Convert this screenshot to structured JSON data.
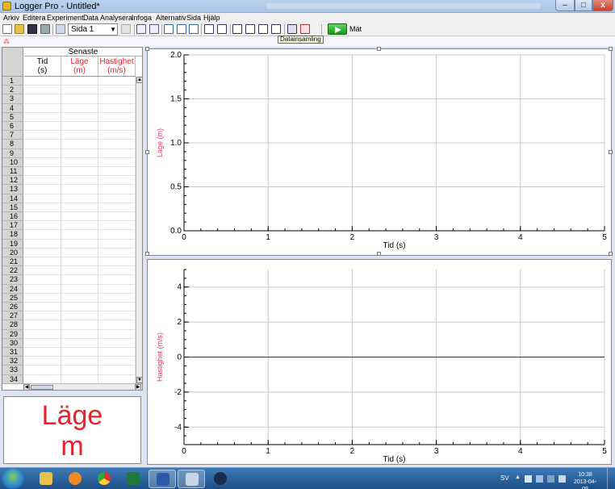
{
  "window": {
    "title": "Logger Pro - Untitled*"
  },
  "menu": [
    "Arkiv",
    "Editera",
    "Experiment",
    "Data",
    "Analysera",
    "Infoga",
    "Alternativ",
    "Sida",
    "Hjälp"
  ],
  "toolbar": {
    "page_select": "Sida 1",
    "collect_label": "Mät",
    "tooltip": "Datainsamling"
  },
  "table": {
    "group_header": "Senaste",
    "columns": [
      {
        "name": "Tid",
        "unit": "(s)",
        "color": "#000000"
      },
      {
        "name": "Läge",
        "unit": "(m)",
        "color": "#e8222d"
      },
      {
        "name": "Hastighet",
        "unit": "(m/s)",
        "color": "#e8222d"
      }
    ],
    "row_numbers": [
      "1",
      "2",
      "3",
      "4",
      "5",
      "6",
      "7",
      "8",
      "9",
      "10",
      "11",
      "12",
      "13",
      "14",
      "15",
      "16",
      "17",
      "18",
      "19",
      "20",
      "21",
      "22",
      "23",
      "24",
      "25",
      "26",
      "27",
      "28",
      "29",
      "30",
      "31",
      "32",
      "33",
      "34"
    ]
  },
  "meter": {
    "label": "Läge",
    "unit": "m",
    "color": "#e8222d"
  },
  "chart_data": [
    {
      "type": "line",
      "title": "",
      "xlabel": "Tid (s)",
      "ylabel": "Läge (m)",
      "xlim": [
        0,
        5
      ],
      "ylim": [
        0,
        2
      ],
      "x_ticks": [
        "0",
        "1",
        "2",
        "3",
        "4",
        "5"
      ],
      "y_ticks": [
        "0.0",
        "0.5",
        "1.0",
        "1.5",
        "2.0"
      ],
      "grid": true,
      "series": []
    },
    {
      "type": "line",
      "title": "",
      "xlabel": "Tid (s)",
      "ylabel": "Hastighet (m/s)",
      "xlim": [
        0,
        5
      ],
      "ylim": [
        -5,
        5
      ],
      "x_ticks": [
        "0",
        "1",
        "2",
        "3",
        "4",
        "5"
      ],
      "y_ticks": [
        "-4",
        "-2",
        "0",
        "2",
        "4"
      ],
      "grid": true,
      "series": []
    }
  ],
  "taskbar": {
    "language": "SV",
    "time": "10:38",
    "date": "2013-04-08"
  },
  "colors": {
    "accent_red": "#e8222d",
    "axis_label_pink": "#e8436b",
    "grid": "#c8c8c8"
  }
}
